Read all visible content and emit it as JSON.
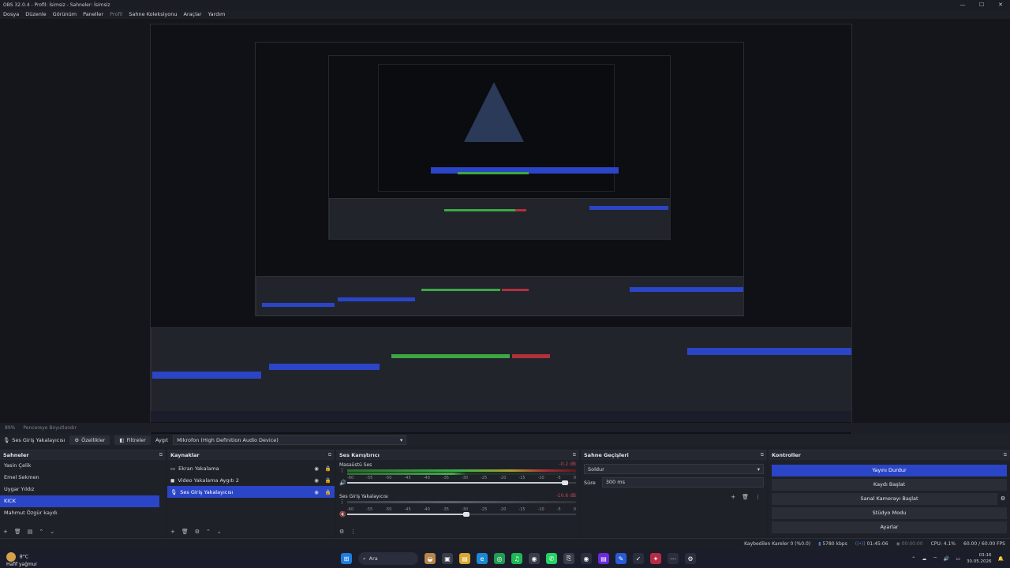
{
  "window": {
    "title": "OBS 32.0.4 - Profil: İsimsiz - Sahneler: İsimsiz",
    "controls": [
      "—",
      "☐",
      "✕"
    ]
  },
  "menu": [
    "Dosya",
    "Düzenle",
    "Görünüm",
    "Paneller",
    "Profil",
    "Sahne Koleksiyonu",
    "Araçlar",
    "Yardım"
  ],
  "preview_toolbar": {
    "zoom": "89%",
    "fit": "Pencereye Boyutlandır"
  },
  "source_toolbar": {
    "current_source": "Ses Giriş Yakalayıcısı",
    "properties": "Özellikler",
    "filters": "Filtreler",
    "device_label": "Aygıt",
    "device_value": "Mikrofon (High Definition Audio Device)"
  },
  "scenes": {
    "title": "Sahneler",
    "items": [
      "Yasin Çelik",
      "Emel Sekmen",
      "Uygar Yıldız",
      "KICK",
      "Mahmut Özgür kaydı"
    ],
    "selected": 3
  },
  "sources": {
    "title": "Kaynaklar",
    "items": [
      "Ekran Yakalama",
      "Video Yakalama Aygıtı 2",
      "Ses Giriş Yakalayıcısı"
    ],
    "selected": 2
  },
  "mixer": {
    "title": "Ses Karıştırıcı",
    "tracks": [
      {
        "name": "Masaüstü Ses",
        "db": "-0.2 dB",
        "volume": 0.95
      },
      {
        "name": "Ses Giriş Yakalayıcısı",
        "db": "-10.6 dB",
        "volume": 0.52
      }
    ],
    "scale": [
      "-60",
      "-55",
      "-50",
      "-45",
      "-40",
      "-35",
      "-30",
      "-25",
      "-20",
      "-15",
      "-10",
      "-5",
      "0"
    ]
  },
  "transitions": {
    "title": "Sahne Geçişleri",
    "selected": "Soldur",
    "duration_label": "Süre",
    "duration_value": "300 ms"
  },
  "controls": {
    "title": "Kontroller",
    "buttons": [
      "Yayını Durdur",
      "Kaydı Başlat",
      "Sanal Kamerayı Başlat",
      "Stüdyo Modu",
      "Ayarlar"
    ]
  },
  "status": {
    "dropped": "Kaybedilen Kareler 0 (%0.0)",
    "bitrate": "5780 kbps",
    "stream_time": "01:45:06",
    "rec_time": "00:00:00",
    "cpu": "CPU: 4.1%",
    "fps": "60.00 / 60.00 FPS"
  },
  "taskbar": {
    "weather_temp": "8°C",
    "weather_desc": "Hafif yağmur",
    "search": "Ara",
    "time": "03:16",
    "date": "30.05.2026"
  },
  "colors": {
    "accent": "#2b45c7",
    "background": "#1d1f26",
    "meter_green": "#3fb048",
    "meter_red": "#a7323b"
  }
}
